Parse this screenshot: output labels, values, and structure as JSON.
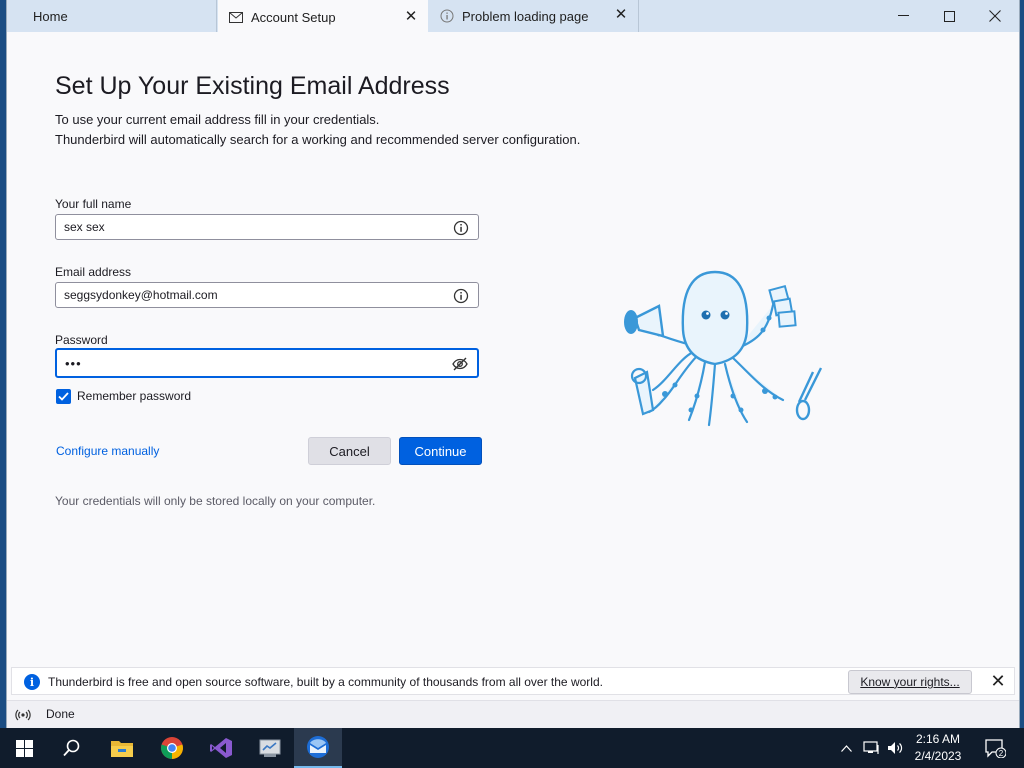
{
  "tabs": [
    {
      "label": "Home"
    },
    {
      "label": "Account Setup"
    },
    {
      "label": "Problem loading page"
    }
  ],
  "setup": {
    "title": "Set Up Your Existing Email Address",
    "subtitle_line1": "To use your current email address fill in your credentials.",
    "subtitle_line2": "Thunderbird will automatically search for a working and recommended server configuration.",
    "full_name_label": "Your full name",
    "full_name_value": "sex sex",
    "email_label": "Email address",
    "email_value": "seggsydonkey@hotmail.com",
    "password_label": "Password",
    "password_value": "•••",
    "remember_label": "Remember password",
    "remember_checked": true,
    "configure_link": "Configure manually",
    "cancel_label": "Cancel",
    "continue_label": "Continue",
    "note": "Your credentials will only be stored locally on your computer."
  },
  "notification": {
    "text": "Thunderbird is free and open source software, built by a community of thousands from all over the world.",
    "button_label": "Know your rights..."
  },
  "status": {
    "text": "Done"
  },
  "taskbar": {
    "time": "2:16 AM",
    "date": "2/4/2023",
    "notification_count": "2",
    "apps": [
      "start-icon",
      "search-icon",
      "file-explorer-icon",
      "chrome-icon",
      "visual-studio-icon",
      "server-manager-icon",
      "thunderbird-icon"
    ]
  },
  "colors": {
    "accent": "#0061e0",
    "tabbar": "#d6e3f2",
    "taskbar": "#101c2c"
  }
}
